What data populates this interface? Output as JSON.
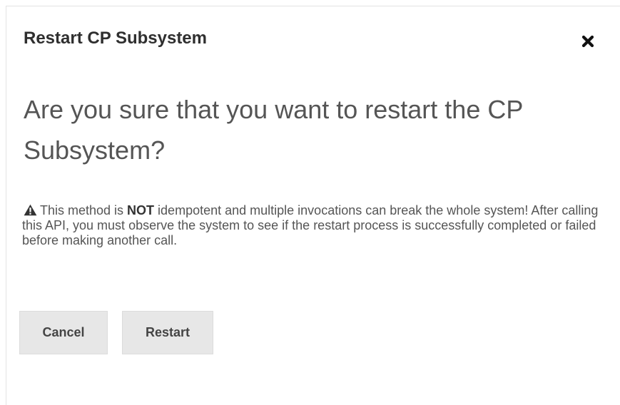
{
  "dialog": {
    "title": "Restart CP Subsystem",
    "close_icon": "close-icon",
    "question": "Are you sure that you want to restart the CP Subsystem?",
    "warning": {
      "icon": "warning-triangle-icon",
      "prefix": "This method is ",
      "emphasis": "NOT",
      "suffix": " idempotent and multiple invocations can break the whole system! After calling this API, you must observe the system to see if the restart process is successfully completed or failed before making another call."
    },
    "buttons": {
      "cancel_label": "Cancel",
      "restart_label": "Restart"
    }
  }
}
